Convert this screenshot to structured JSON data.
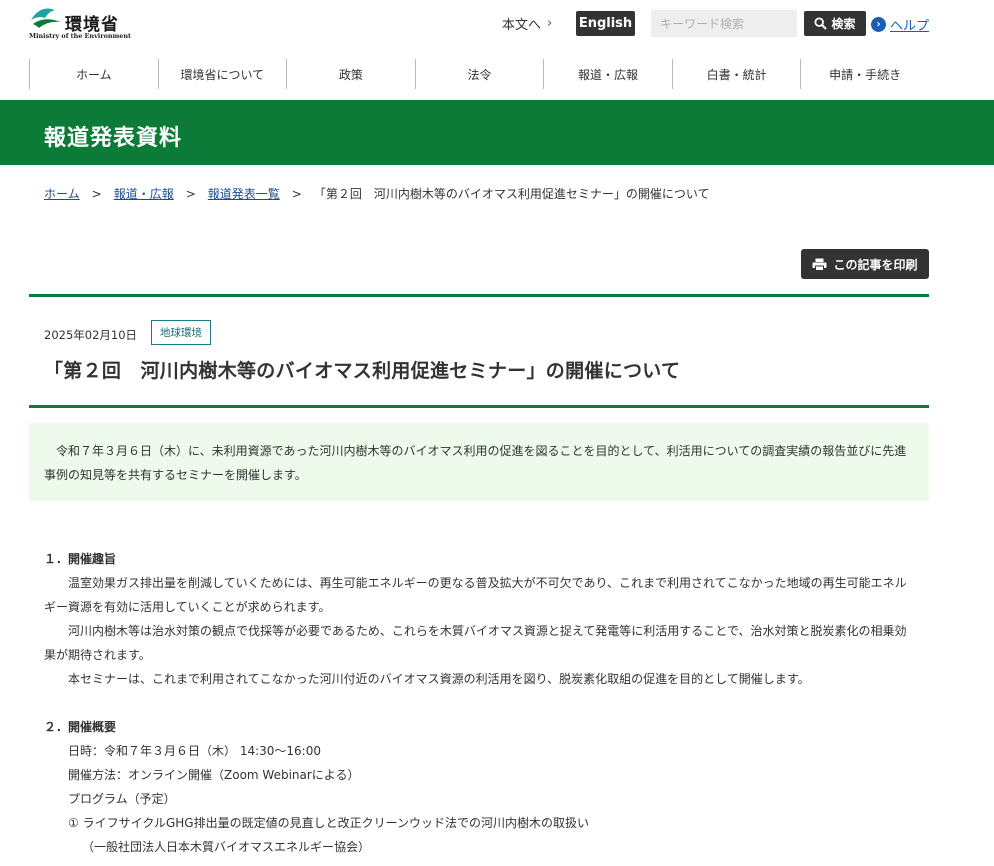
{
  "header": {
    "logo_text": "環境省",
    "logo_sub": "Ministry of the Environment",
    "skip_link": "本文へ",
    "english_label": "English",
    "search_placeholder": "キーワード検索",
    "search_button": "検索",
    "help_label": "ヘルプ"
  },
  "nav": {
    "items": [
      "ホーム",
      "環境省について",
      "政策",
      "法令",
      "報道・広報",
      "白書・統計",
      "申請・手続き"
    ]
  },
  "banner": {
    "title": "報道発表資料"
  },
  "breadcrumb": {
    "items": [
      "ホーム",
      "報道・広報",
      "報道発表一覧"
    ],
    "current": "「第２回　河川内樹木等のバイオマス利用促進セミナー」の開催について"
  },
  "article": {
    "print_label": "この記事を印刷",
    "date": "2025年02月10日",
    "tag": "地球環境",
    "title": "「第２回　河川内樹木等のバイオマス利用促進セミナー」の開催について",
    "lead_line1": "令和７年３月６日（木）に、未利用資源であった河川内樹木等のバイオマス利用の促進を図ることを目的として、利活用についての調査実績の報告並びに先進",
    "lead_line2": "事例の知見等を共有するセミナーを開催します。"
  },
  "section1": {
    "heading": "１．開催趣旨",
    "p1_line1": "温室効果ガス排出量を削減していくためには、再生可能エネルギーの更なる普及拡大が不可欠であり、これまで利用されてこなかった地域の再生可能エネル",
    "p1_line2": "ギー資源を有効に活用していくことが求められます。",
    "p2_line1": "河川内樹木等は治水対策の観点で伐採等が必要であるため、これらを木質バイオマス資源と捉えて発電等に利活用することで、治水対策と脱炭素化の相乗効",
    "p2_line2": "果が期待されます。",
    "p3": "本セミナーは、これまで利用されてこなかった河川付近のバイオマス資源の利活用を図り、脱炭素化取組の促進を目的として開催します。"
  },
  "section2": {
    "heading": "２．開催概要",
    "datetime": "日時：令和７年３月６日（木） 14:30〜16:00",
    "method": "開催方法：オンライン開催（Zoom Webinarによる）",
    "program": "プログラム（予定）",
    "item1": "① ライフサイクルGHG排出量の既定値の見直しと改正クリーンウッド法での河川内樹木の取扱い",
    "item1_org": "（一般社団法人日本木質バイオマスエネルギー協会）"
  }
}
